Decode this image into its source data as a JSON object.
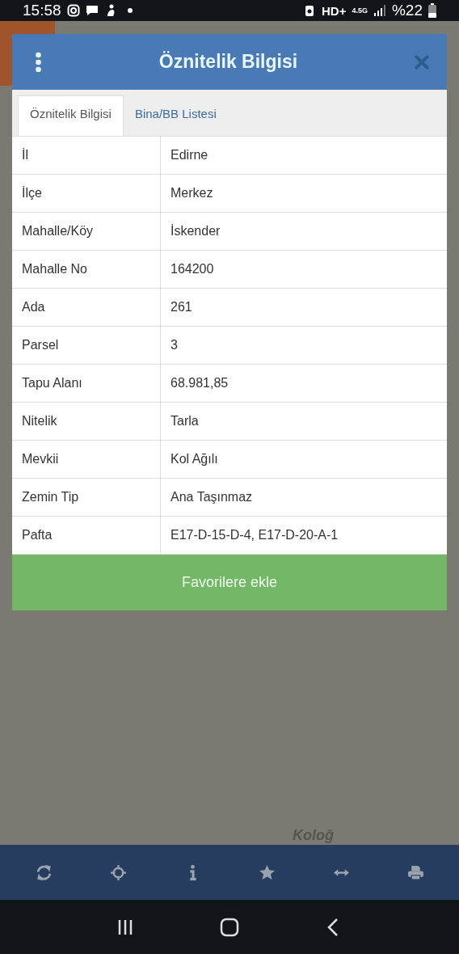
{
  "status_bar": {
    "time": "15:58",
    "hd": "HD+",
    "network": "4.5G",
    "battery": "%22"
  },
  "map": {
    "label": "Koloğ"
  },
  "dialog": {
    "title": "Öznitelik Bilgisi",
    "tabs": [
      {
        "label": "Öznitelik Bilgisi",
        "selected": true
      },
      {
        "label": "Bina/BB Listesi",
        "selected": false
      }
    ],
    "rows": [
      {
        "label": "İl",
        "value": "Edirne"
      },
      {
        "label": "İlçe",
        "value": "Merkez"
      },
      {
        "label": "Mahalle/Köy",
        "value": "İskender"
      },
      {
        "label": "Mahalle No",
        "value": "164200"
      },
      {
        "label": "Ada",
        "value": "261"
      },
      {
        "label": "Parsel",
        "value": "3"
      },
      {
        "label": "Tapu Alanı",
        "value": "68.981,85"
      },
      {
        "label": "Nitelik",
        "value": "Tarla"
      },
      {
        "label": "Mevkii",
        "value": "Kol Ağılı"
      },
      {
        "label": "Zemin Tip",
        "value": "Ana Taşınmaz"
      },
      {
        "label": "Pafta",
        "value": "E17-D-15-D-4, E17-D-20-A-1"
      }
    ],
    "button": "Favorilere ekle"
  },
  "toolbar": [
    {
      "kind": "refresh"
    },
    {
      "kind": "locate"
    },
    {
      "kind": "info"
    },
    {
      "kind": "star"
    },
    {
      "kind": "measure"
    },
    {
      "kind": "print"
    }
  ]
}
